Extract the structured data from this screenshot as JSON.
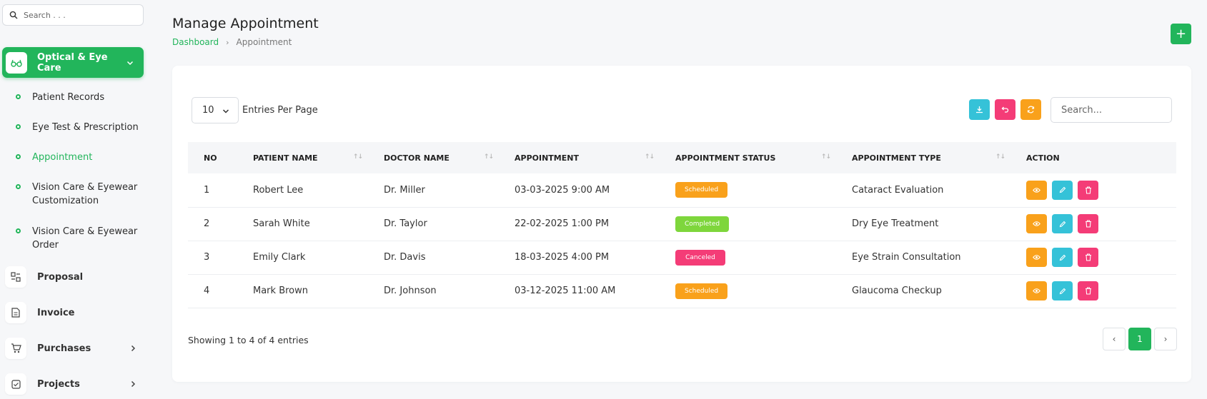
{
  "sidebar": {
    "search_placeholder": "Search . . .",
    "active_menu": "Optical & Eye Care",
    "sub_items": [
      {
        "label": "Patient Records"
      },
      {
        "label": "Eye Test & Prescription"
      },
      {
        "label": "Appointment",
        "active": true
      },
      {
        "label": "Vision Care & Eyewear Customization"
      },
      {
        "label": "Vision Care & Eyewear Order"
      }
    ],
    "menu_items": [
      {
        "label": "Proposal",
        "icon": "proposal-icon"
      },
      {
        "label": "Invoice",
        "icon": "invoice-icon"
      },
      {
        "label": "Purchases",
        "icon": "cart-icon",
        "has_children": true
      },
      {
        "label": "Projects",
        "icon": "projects-icon",
        "has_children": true
      }
    ]
  },
  "header": {
    "title": "Manage Appointment",
    "breadcrumb_home": "Dashboard",
    "breadcrumb_current": "Appointment",
    "add_label": "+"
  },
  "table_controls": {
    "entries_value": "10",
    "entries_label": "Entries Per Page",
    "search_placeholder": "Search..."
  },
  "columns": [
    "NO",
    "PATIENT NAME",
    "DOCTOR NAME",
    "APPOINTMENT",
    "APPOINTMENT STATUS",
    "APPOINTMENT TYPE",
    "ACTION"
  ],
  "rows": [
    {
      "no": "1",
      "patient": "Robert Lee",
      "doctor": "Dr. Miller",
      "appointment": "03-03-2025 9:00 AM",
      "status": "Scheduled",
      "type": "Cataract Evaluation"
    },
    {
      "no": "2",
      "patient": "Sarah White",
      "doctor": "Dr. Taylor",
      "appointment": "22-02-2025 1:00 PM",
      "status": "Completed",
      "type": "Dry Eye Treatment"
    },
    {
      "no": "3",
      "patient": "Emily Clark",
      "doctor": "Dr. Davis",
      "appointment": "18-03-2025 4:00 PM",
      "status": "Canceled",
      "type": "Eye Strain Consultation"
    },
    {
      "no": "4",
      "patient": "Mark Brown",
      "doctor": "Dr. Johnson",
      "appointment": "03-12-2025 11:00 AM",
      "status": "Scheduled",
      "type": "Glaucoma Checkup"
    }
  ],
  "status_colors": {
    "Scheduled": "#f9a11b",
    "Completed": "#7ed63c",
    "Canceled": "#f43c77"
  },
  "colors": {
    "accent": "#22b55b"
  },
  "footer": {
    "showing": "Showing 1 to 4 of 4 entries",
    "current_page": "1",
    "prev_label": "‹",
    "next_label": "›"
  }
}
